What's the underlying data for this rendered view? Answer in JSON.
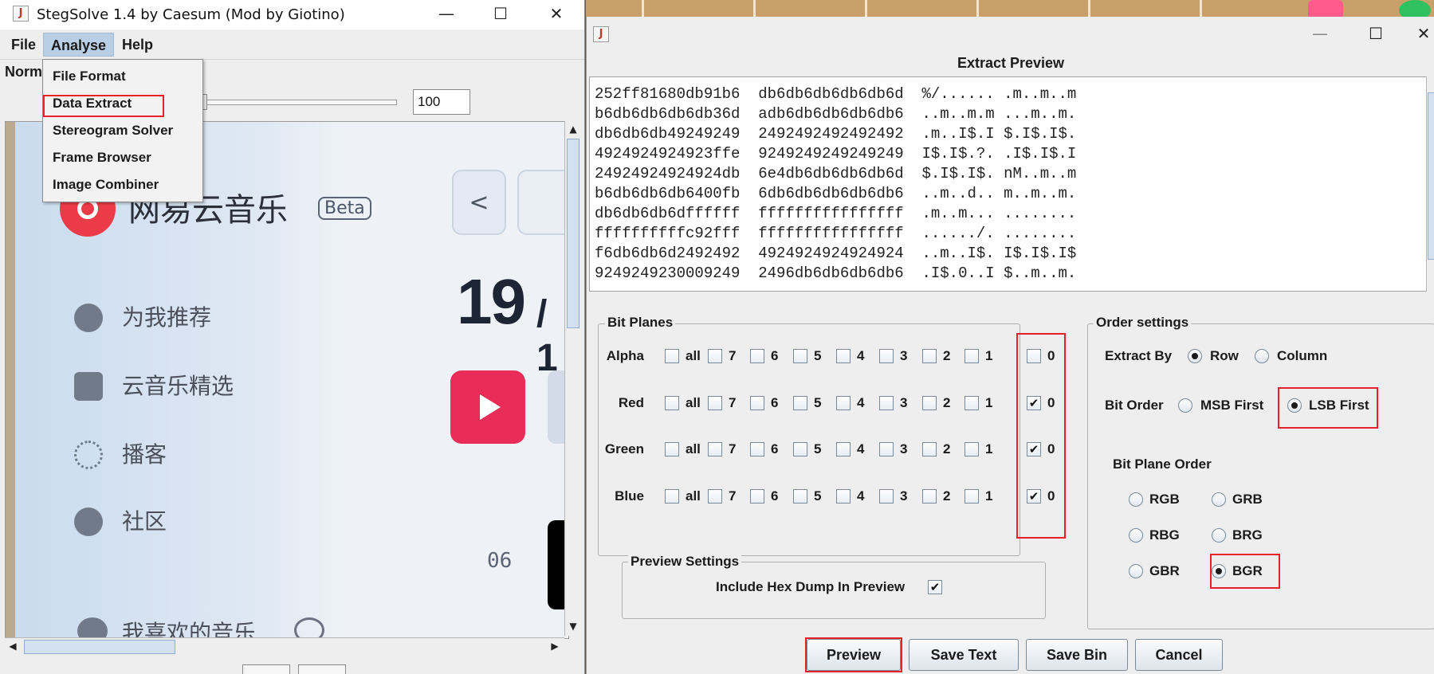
{
  "left_window": {
    "title": "StegSolve 1.4 by Caesum (Mod by Giotino)",
    "menus": [
      "File",
      "Analyse",
      "Help"
    ],
    "mode_label": "Norm",
    "zoom_value": "100",
    "dropdown_items": [
      "File Format",
      "Data Extract",
      "Stereogram Solver",
      "Frame Browser",
      "Image Combiner"
    ],
    "image": {
      "app_name": "网易云音乐",
      "badge": "Beta",
      "nav_items": [
        "为我推荐",
        "云音乐精选",
        "播客",
        "社区"
      ],
      "favorites_label": "我喜欢的音乐",
      "back_symbol": "<",
      "date_day": "19",
      "date_sep": "/ 1",
      "small_number": "06"
    }
  },
  "right_window": {
    "dialog_title": "Extract Preview",
    "hex_lines": [
      "252ff81680db91b6  db6db6db6db6db6d  %/...... .m..m..m",
      "b6db6db6db6db36d  adb6db6db6db6db6  ..m..m.m ...m..m.",
      "db6db6db49249249  2492492492492492  .m..I$.I $.I$.I$.",
      "4924924924923ffe  9249249249249249  I$.I$.?. .I$.I$.I",
      "24924924924924db  6e4db6db6db6db6d  $.I$.I$. nM..m..m",
      "b6db6db6db6400fb  6db6db6db6db6db6  ..m..d.. m..m..m.",
      "db6db6db6dffffff  ffffffffffffffff  .m..m... ........",
      "ffffffffffc92fff  ffffffffffffffff  ....../. ........",
      "f6db6db6d2492492  4924924924924924  ..m..I$. I$.I$.I$",
      "9249249230009249  2496db6db6db6db6  .I$.0..I $..m..m."
    ],
    "bit_planes": {
      "title": "Bit Planes",
      "bit_labels": [
        "all",
        "7",
        "6",
        "5",
        "4",
        "3",
        "2",
        "1",
        "0"
      ],
      "rows": [
        {
          "name": "Alpha",
          "checked": [
            false,
            false,
            false,
            false,
            false,
            false,
            false,
            false,
            false
          ]
        },
        {
          "name": "Red",
          "checked": [
            false,
            false,
            false,
            false,
            false,
            false,
            false,
            false,
            true
          ]
        },
        {
          "name": "Green",
          "checked": [
            false,
            false,
            false,
            false,
            false,
            false,
            false,
            false,
            true
          ]
        },
        {
          "name": "Blue",
          "checked": [
            false,
            false,
            false,
            false,
            false,
            false,
            false,
            false,
            true
          ]
        }
      ]
    },
    "preview_settings": {
      "title": "Preview Settings",
      "hex_dump_label": "Include Hex Dump In Preview",
      "hex_dump_checked": true
    },
    "order_settings": {
      "title": "Order settings",
      "extract_by_label": "Extract By",
      "extract_by_options": [
        "Row",
        "Column"
      ],
      "extract_by_selected": "Row",
      "bit_order_label": "Bit Order",
      "bit_order_options": [
        "MSB First",
        "LSB First"
      ],
      "bit_order_selected": "LSB First",
      "plane_order_label": "Bit Plane Order",
      "plane_order_options": [
        "RGB",
        "GRB",
        "RBG",
        "BRG",
        "GBR",
        "BGR"
      ],
      "plane_order_selected": "BGR"
    },
    "buttons": [
      "Preview",
      "Save Text",
      "Save Bin",
      "Cancel"
    ],
    "check_mark": "✔"
  },
  "window_controls": {
    "minimize": "—",
    "maximize": "☐",
    "close": "✕"
  },
  "highlight_color": "#e8202a"
}
